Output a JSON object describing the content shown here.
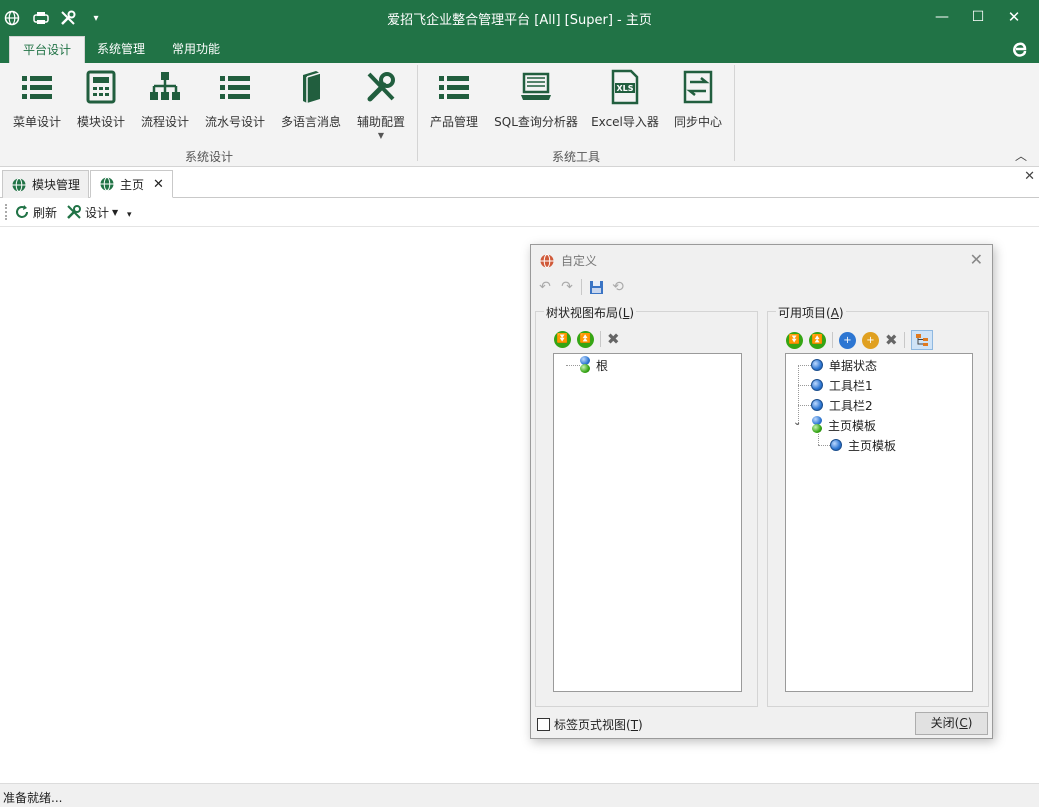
{
  "window": {
    "title": "爱招飞企业整合管理平台 [All] [Super] - 主页",
    "colors": {
      "accent": "#217346"
    }
  },
  "quick_access": [
    "globe-icon",
    "printer-icon",
    "wrench-icon",
    "dropdown-icon"
  ],
  "ribbon": {
    "tabs": [
      "平台设计",
      "系统管理",
      "常用功能"
    ],
    "active_tab": "平台设计",
    "groups": [
      {
        "label": "系统设计",
        "buttons": [
          "菜单设计",
          "模块设计",
          "流程设计",
          "流水号设计",
          "多语言消息",
          "辅助配置"
        ]
      },
      {
        "label": "系统工具",
        "buttons": [
          "产品管理",
          "SQL查询分析器",
          "Excel导入器",
          "同步中心"
        ]
      }
    ]
  },
  "doc_tabs": [
    {
      "label": "模块管理"
    },
    {
      "label": "主页"
    }
  ],
  "toolbar": {
    "refresh": "刷新",
    "design": "设计"
  },
  "status": "准备就绪...",
  "dialog": {
    "title": "自定义",
    "left_group": {
      "label": "树状视图布局",
      "hotkey": "L",
      "nodes": [
        "根"
      ]
    },
    "right_group": {
      "label": "可用项目",
      "hotkey": "A",
      "nodes": [
        "单据状态",
        "工具栏1",
        "工具栏2",
        "主页模板",
        "主页模板"
      ]
    },
    "checkbox_label": "标签页式视图",
    "checkbox_hotkey": "T",
    "checkbox_checked": false,
    "close_label": "关闭",
    "close_hotkey": "C"
  }
}
